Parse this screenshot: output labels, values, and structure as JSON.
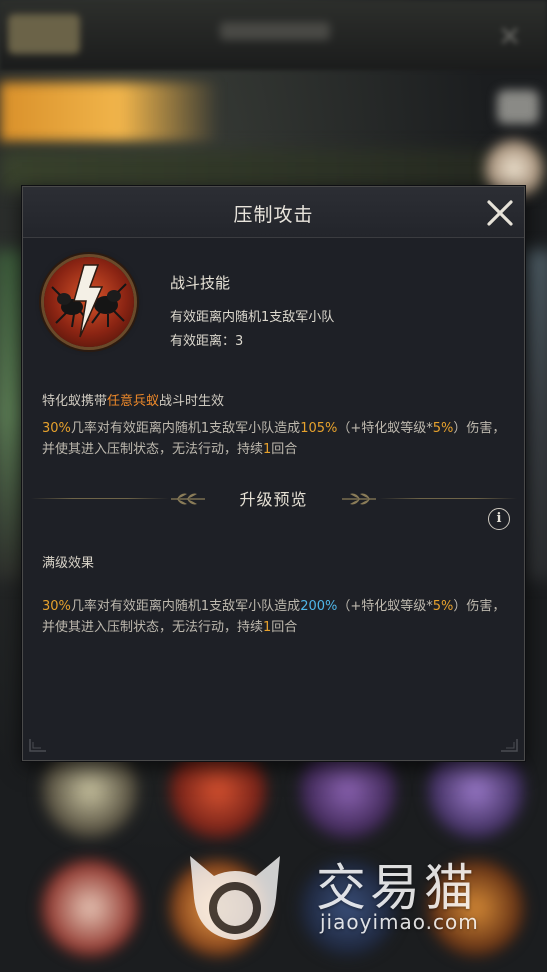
{
  "dialog": {
    "title": "压制攻击"
  },
  "skill": {
    "icon": "ant-lightning-icon",
    "type": "战斗技能",
    "desc_target": "有效距离内随机1支敌军小队",
    "desc_range": "有效距离：3"
  },
  "carry": {
    "prefix": "特化蚁携带",
    "highlight": "任意兵蚁",
    "suffix": "战斗时生效"
  },
  "effect_current": {
    "chance": "30%",
    "text1": "几率对有效距离内随机1支敌军小队造成",
    "damage": "105%",
    "text2": "（+特化蚁等级*",
    "level_bonus": "5%",
    "text3": "）伤害，并使其进入压制状态，无法行动，持续",
    "rounds": "1",
    "text4": "回合"
  },
  "upgrade": {
    "section_title": "升级预览",
    "max_title": "满级效果"
  },
  "effect_max": {
    "chance": "30%",
    "text1": "几率对有效距离内随机1支敌军小队造成",
    "damage": "200%",
    "text2": "（+特化蚁等级*",
    "level_bonus": "5%",
    "text3": "）伤害，并使其进入压制状态，无法行动，持续",
    "rounds": "1",
    "text4": "回合"
  },
  "watermark": {
    "brand": "交易猫",
    "url": "jiaoyimao.com"
  },
  "colors": {
    "highlight_orange": "#f08a2a",
    "number_gold": "#e6a12d",
    "upgrade_blue": "#4fb6e8"
  }
}
